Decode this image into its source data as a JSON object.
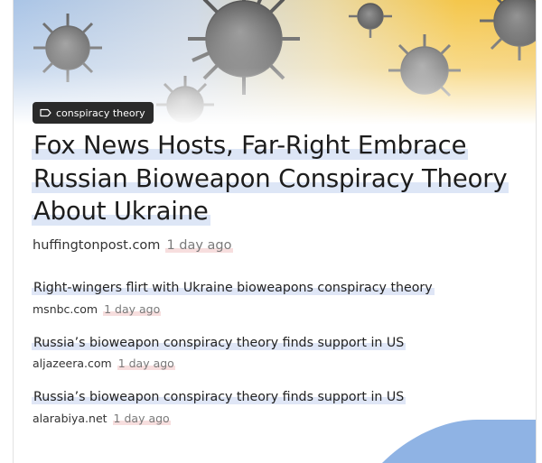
{
  "article": {
    "tag": "conspiracy theory",
    "headline": "Fox News Hosts, Far-Right Embrace Russian Bioweapon Conspiracy Theory About Ukraine",
    "source": "huffingtonpost.com",
    "time": "1 day ago",
    "tag_icon": "tag-icon",
    "hero_image": "virus-illustration"
  },
  "related": [
    {
      "title": "Right-wingers flirt with Ukraine bioweapons conspiracy theory",
      "source": "msnbc.com",
      "time": "1 day ago"
    },
    {
      "title": "Russia’s bioweapon conspiracy theory finds support in US",
      "source": "aljazeera.com",
      "time": "1 day ago"
    },
    {
      "title": "Russia’s bioweapon conspiracy theory finds support in US",
      "source": "alarabiya.net",
      "time": "1 day ago"
    }
  ],
  "colors": {
    "tag_bg": "#2a2a2a",
    "highlight": "#dde6f6",
    "time_underline": "#f7dede",
    "hero_yellow": "#f4c64a",
    "hero_blue": "#9fc0e8",
    "corner_blue": "#8fb3e4"
  }
}
